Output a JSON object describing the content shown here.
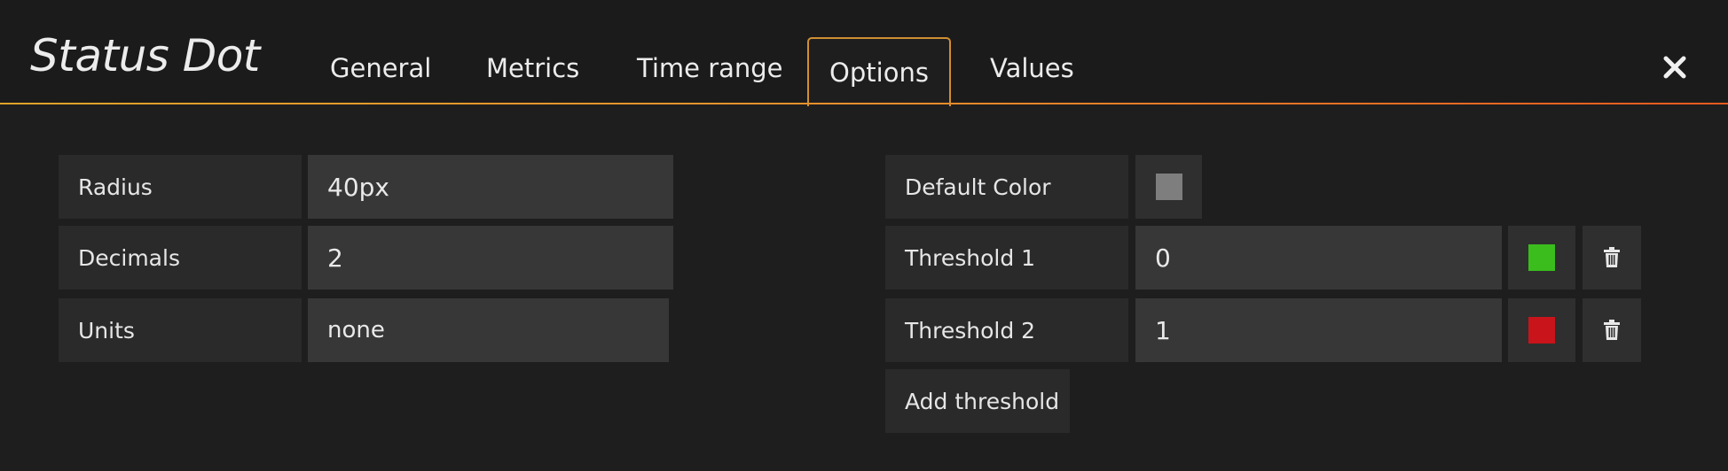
{
  "header": {
    "title": "Status Dot",
    "tabs": [
      {
        "label": "General"
      },
      {
        "label": "Metrics"
      },
      {
        "label": "Time range"
      },
      {
        "label": "Options"
      },
      {
        "label": "Values"
      }
    ],
    "active_tab": "Options",
    "close_icon": "close-icon"
  },
  "left_form": {
    "radius": {
      "label": "Radius",
      "value": "40px"
    },
    "decimals": {
      "label": "Decimals",
      "value": "2"
    },
    "units": {
      "label": "Units",
      "value": "none"
    }
  },
  "right_form": {
    "default_color": {
      "label": "Default Color",
      "color": "#7e7e7e"
    },
    "thresholds": [
      {
        "label": "Threshold 1",
        "value": "0",
        "color": "#3bbd1d"
      },
      {
        "label": "Threshold 2",
        "value": "1",
        "color": "#c8141a"
      }
    ],
    "add_threshold_label": "Add threshold",
    "delete_icon": "trash-icon"
  }
}
